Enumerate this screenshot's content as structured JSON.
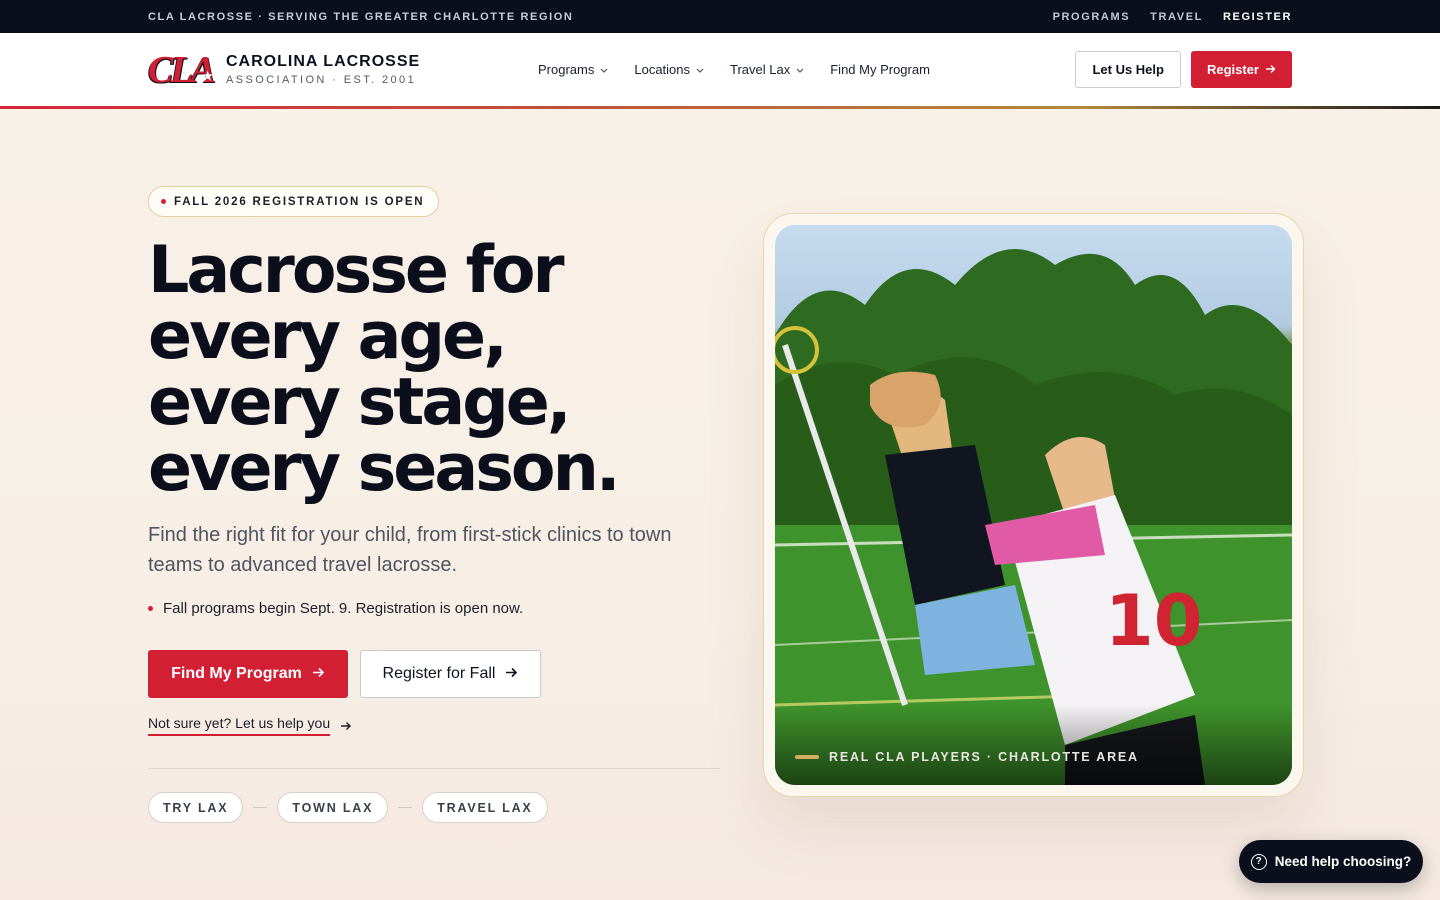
{
  "topbar": {
    "tagline": "CLA LACROSSE · SERVING THE GREATER CHARLOTTE REGION",
    "links": [
      "PROGRAMS",
      "TRAVEL",
      "REGISTER"
    ]
  },
  "header": {
    "logo_mark": "CLA",
    "logo_name": "CAROLINA LACROSSE",
    "logo_sub": "ASSOCIATION · EST. 2001",
    "nav": [
      "Programs",
      "Locations",
      "Travel Lax",
      "Find My Program"
    ],
    "help_button": "Let Us Help",
    "register_button": "Register",
    "arrow": "→",
    "chevron": "⌄"
  },
  "hero": {
    "badge": "FALL 2026 REGISTRATION IS OPEN",
    "headline": {
      "line1": "Lacrosse for",
      "line2": "every age,",
      "line3": "every stage,",
      "line4": "every season."
    },
    "lede": "Find the right fit for your child, from first-stick clinics to town teams to advanced travel lacrosse.",
    "notice": "Fall programs begin Sept. 9. Registration is open now.",
    "cta_primary": "Find My Program",
    "cta_secondary": "Register for Fall",
    "help_link": "Not sure yet? Let us help you",
    "pills": [
      "TRY LAX",
      "TOWN LAX",
      "TRAVEL LAX"
    ]
  },
  "photo": {
    "caption": "REAL CLA PLAYERS · CHARLOTTE AREA"
  },
  "help_widget": {
    "label": "Need help choosing?"
  },
  "colors": {
    "brand_red": "#d21f33",
    "navy": "#0b0f1c",
    "gold": "#d4ae60"
  },
  "icons": {
    "help": "question-circle-icon",
    "arrow": "arrow-right-icon",
    "chevron": "chevron-down-icon"
  }
}
